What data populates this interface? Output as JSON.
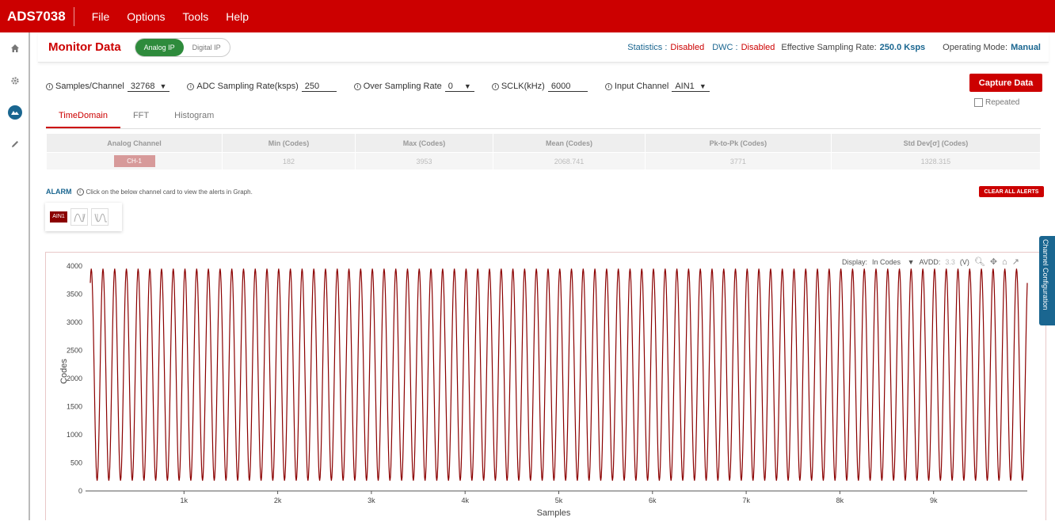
{
  "app": {
    "title": "ADS7038",
    "menu": [
      "File",
      "Options",
      "Tools",
      "Help"
    ]
  },
  "nav": {
    "icons": [
      "home-icon",
      "gear-icon",
      "monitor-icon",
      "pencil-icon"
    ]
  },
  "header": {
    "title": "Monitor Data",
    "toggle": {
      "on": "Analog IP",
      "off": "Digital IP"
    },
    "status": {
      "stats_label": "Statistics :",
      "stats_value": "Disabled",
      "dwc_label": "DWC :",
      "dwc_value": "Disabled",
      "rate_label": "Effective Sampling Rate:",
      "rate_value": "250.0 Ksps",
      "mode_label": "Operating Mode:",
      "mode_value": "Manual"
    }
  },
  "params": {
    "samples_label": "Samples/Channel",
    "samples_value": "32768",
    "adc_label": "ADC Sampling Rate(ksps)",
    "adc_value": "250",
    "osr_label": "Over Sampling Rate",
    "osr_value": "0",
    "sclk_label": "SCLK(kHz)",
    "sclk_value": "6000",
    "input_label": "Input Channel",
    "input_value": "AIN1"
  },
  "actions": {
    "capture": "Capture Data",
    "repeated": "Repeated"
  },
  "tabs": [
    "TimeDomain",
    "FFT",
    "Histogram"
  ],
  "stats_table": {
    "headers": [
      "Analog Channel",
      "Min (Codes)",
      "Max (Codes)",
      "Mean (Codes)",
      "Pk-to-Pk (Codes)",
      "Std Dev[σ] (Codes)"
    ],
    "row": [
      "CH-1",
      "182",
      "3953",
      "2068.741",
      "3771",
      "1328.315"
    ]
  },
  "alarm": {
    "title": "ALARM",
    "hint": "Click on the below channel card to view the alerts in Graph.",
    "clear": "CLEAR ALL ALERTS",
    "card_label": "AIN1"
  },
  "side_tab": "Channel Configuration",
  "chart_toolbar": {
    "display_label": "Display:",
    "display_value": "In Codes",
    "avdd_label": "AVDD:",
    "avdd_value": "3.3",
    "unit": "(V)"
  },
  "colors": {
    "brand": "#cc0000",
    "accent": "#1a6690",
    "series": "#8b0000"
  },
  "chart_data": {
    "type": "line",
    "xlabel": "Samples",
    "ylabel": "Codes",
    "xlim": [
      0,
      10000
    ],
    "ylim": [
      0,
      4000
    ],
    "xticks": [
      "1k",
      "2k",
      "3k",
      "4k",
      "5k",
      "6k",
      "7k",
      "8k",
      "9k"
    ],
    "yticks": [
      "0",
      "500",
      "1000",
      "1500",
      "2000",
      "2500",
      "3000",
      "3500",
      "4000"
    ],
    "grid": false,
    "series": [
      {
        "min": 182,
        "max": 3953,
        "cycles": 80,
        "start_value": 3700
      }
    ]
  }
}
